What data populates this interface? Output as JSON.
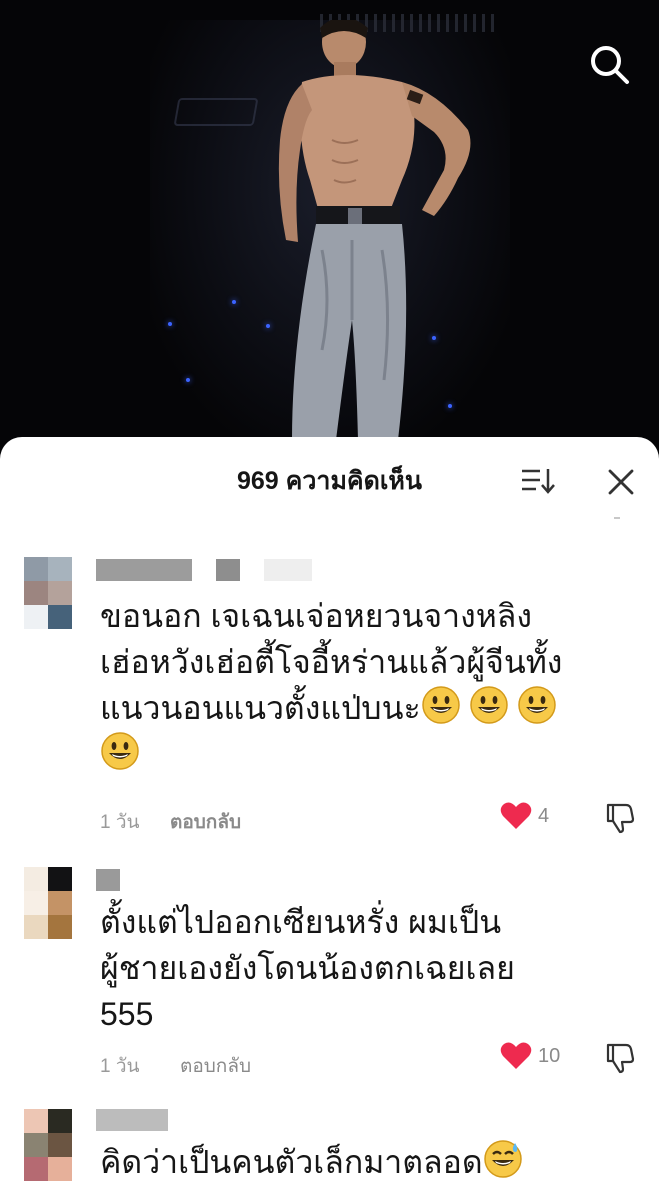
{
  "header": {
    "comment_count_title": "969 ความคิดเห็น"
  },
  "icons": {
    "search": "search-icon",
    "sort": "sort-icon",
    "close": "close-icon",
    "like": "heart-icon",
    "dislike": "thumbs-down-icon",
    "emoji_grin": "grinning-face-emoji",
    "emoji_sweat": "grinning-sweat-emoji"
  },
  "colors": {
    "like_active": "#ee2a4f",
    "text_primary": "#161616",
    "text_muted": "#9a9a9a",
    "sheet_bg": "#ffffff",
    "video_bg": "#050507"
  },
  "comments": [
    {
      "text": "ขอนอก เจเฉนเจ่อหยวนจางหลิง\nเฮ่อหวังเฮ่อตี้โจอี้หร่านแล้วผู้จีนทั้ง\nแนวนอนแนวตั้งแป่บนะ",
      "emoji_count": 4,
      "time": "1 วัน",
      "reply_label": "ตอบกลับ",
      "likes": "4",
      "liked": true
    },
    {
      "text": "ตั้งแต่ไปออกเซียนหรั่ง ผมเป็น\nผู้ชายเองยังโดนน้องตกเฉยเลย\n555",
      "time": "1 วัน",
      "reply_label": "ตอบกลับ",
      "likes": "10",
      "liked": true
    },
    {
      "text": "คิดว่าเป็นคนตัวเล็กมาตลอด",
      "emoji_count": 1
    }
  ]
}
